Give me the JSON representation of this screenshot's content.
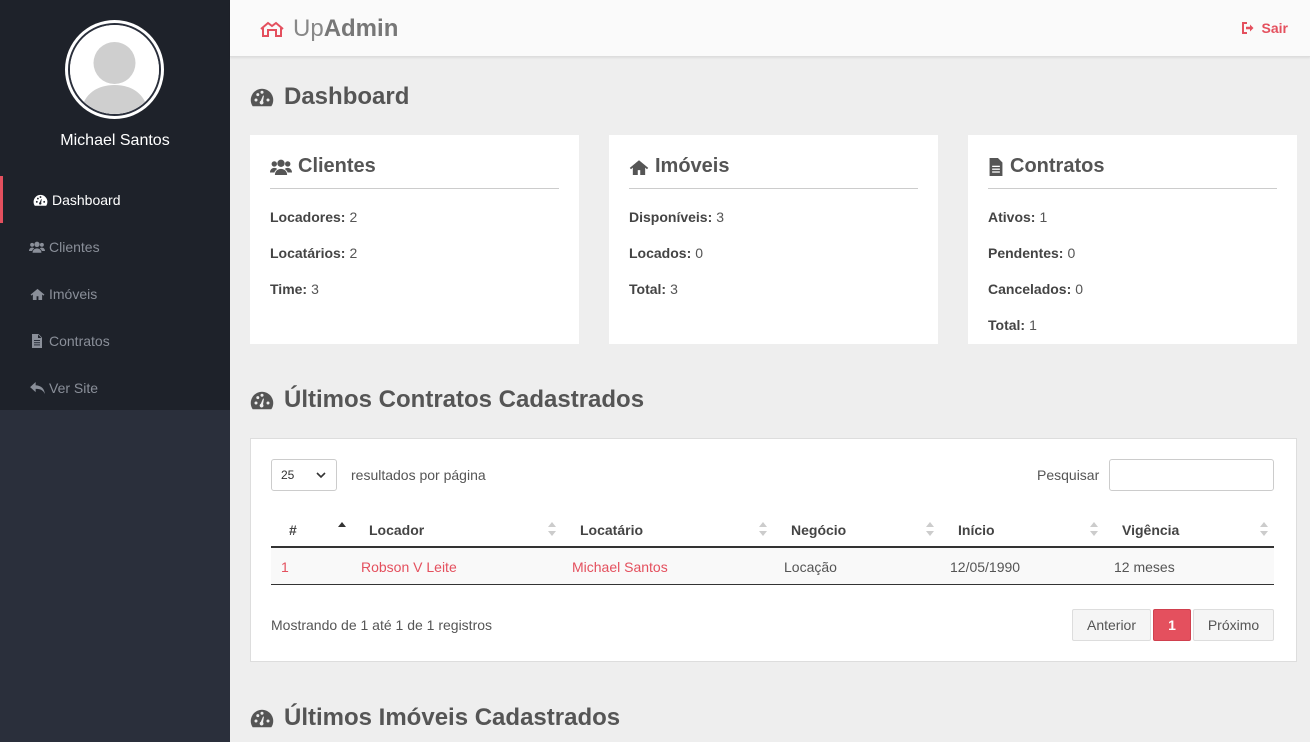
{
  "sidebar": {
    "user_name": "Michael Santos",
    "items": [
      {
        "label": "Dashboard",
        "icon": "dashboard-icon",
        "active": true
      },
      {
        "label": "Clientes",
        "icon": "users-icon"
      },
      {
        "label": "Imóveis",
        "icon": "home-icon"
      },
      {
        "label": "Contratos",
        "icon": "document-icon"
      },
      {
        "label": "Ver Site",
        "icon": "reply-icon"
      }
    ]
  },
  "header": {
    "brand_light": "Up",
    "brand_bold": "Admin",
    "logout_label": "Sair"
  },
  "dashboard": {
    "title": "Dashboard",
    "cards": [
      {
        "title": "Clientes",
        "icon": "users-icon",
        "rows": [
          {
            "label": "Locadores:",
            "value": "2"
          },
          {
            "label": "Locatários:",
            "value": "2"
          },
          {
            "label": "Time:",
            "value": "3"
          }
        ]
      },
      {
        "title": "Imóveis",
        "icon": "home-icon",
        "rows": [
          {
            "label": "Disponíveis:",
            "value": "3"
          },
          {
            "label": "Locados:",
            "value": "0"
          },
          {
            "label": "Total:",
            "value": "3"
          }
        ]
      },
      {
        "title": "Contratos",
        "icon": "document-icon",
        "rows": [
          {
            "label": "Ativos:",
            "value": "1"
          },
          {
            "label": "Pendentes:",
            "value": "0"
          },
          {
            "label": "Cancelados:",
            "value": "0"
          },
          {
            "label": "Total:",
            "value": "1"
          }
        ]
      }
    ]
  },
  "contracts": {
    "title": "Últimos Contratos Cadastrados",
    "page_length": "25",
    "length_label": "resultados por página",
    "search_label": "Pesquisar",
    "search_value": "",
    "columns": [
      "#",
      "Locador",
      "Locatário",
      "Negócio",
      "Início",
      "Vigência"
    ],
    "rows": [
      [
        "1",
        "Robson V Leite",
        "Michael Santos",
        "Locação",
        "12/05/1990",
        "12 meses"
      ]
    ],
    "info": "Mostrando de 1 até 1 de 1 registros",
    "pagination": {
      "prev": "Anterior",
      "current": "1",
      "next": "Próximo"
    }
  },
  "properties": {
    "title": "Últimos Imóveis Cadastrados"
  },
  "colors": {
    "accent": "#e4505e",
    "sidebar": "#1e222a"
  }
}
